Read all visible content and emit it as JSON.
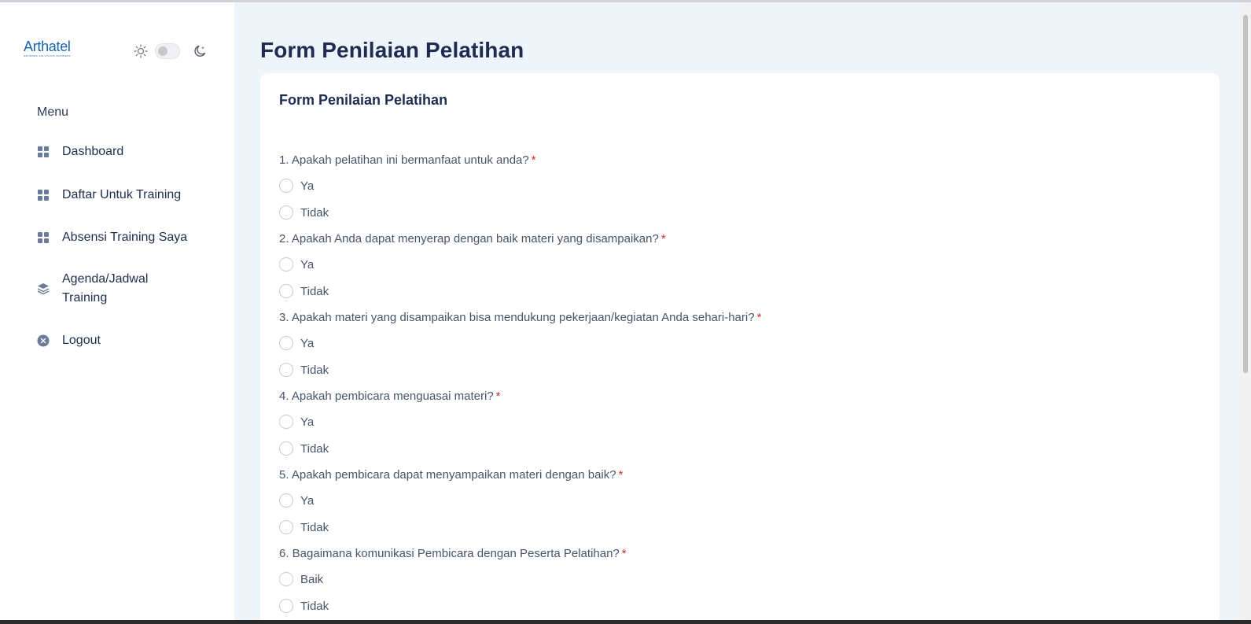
{
  "brand": {
    "name": "Arthatel",
    "tagline": "NETWORK SOLUTIONS BUSINESS",
    "color": "#1563b0"
  },
  "theme_toggle": {
    "sun_icon": "sun-icon",
    "moon_icon": "moon-icon",
    "dark_mode": false
  },
  "sidebar": {
    "menu_title": "Menu",
    "items": [
      {
        "label": "Dashboard",
        "icon": "grid-icon"
      },
      {
        "label": "Daftar Untuk Training",
        "icon": "grid-icon"
      },
      {
        "label": "Absensi Training Saya",
        "icon": "grid-icon"
      },
      {
        "label": "Agenda/Jadwal Training",
        "icon": "layers-icon"
      },
      {
        "label": "Logout",
        "icon": "close-circle-icon"
      }
    ]
  },
  "page": {
    "title": "Form Penilaian Pelatihan",
    "card_title": "Form Penilaian Pelatihan"
  },
  "form": {
    "required_mark": "*",
    "questions": [
      {
        "text": "1. Apakah pelatihan ini bermanfaat untuk anda?",
        "options": [
          "Ya",
          "Tidak"
        ]
      },
      {
        "text": "2. Apakah Anda dapat menyerap dengan baik materi yang disampaikan?",
        "options": [
          "Ya",
          "Tidak"
        ]
      },
      {
        "text": "3. Apakah materi yang disampaikan bisa mendukung pekerjaan/kegiatan Anda sehari-hari?",
        "options": [
          "Ya",
          "Tidak"
        ]
      },
      {
        "text": "4. Apakah pembicara menguasai materi?",
        "options": [
          "Ya",
          "Tidak"
        ]
      },
      {
        "text": "5. Apakah pembicara dapat menyampaikan materi dengan baik?",
        "options": [
          "Ya",
          "Tidak"
        ]
      },
      {
        "text": "6. Bagaimana komunikasi Pembicara dengan Peserta Pelatihan?",
        "options": [
          "Baik",
          "Tidak"
        ]
      }
    ]
  },
  "colors": {
    "background": "#eff4fb",
    "heading": "#1d2c50",
    "required": "#d12d2d"
  }
}
